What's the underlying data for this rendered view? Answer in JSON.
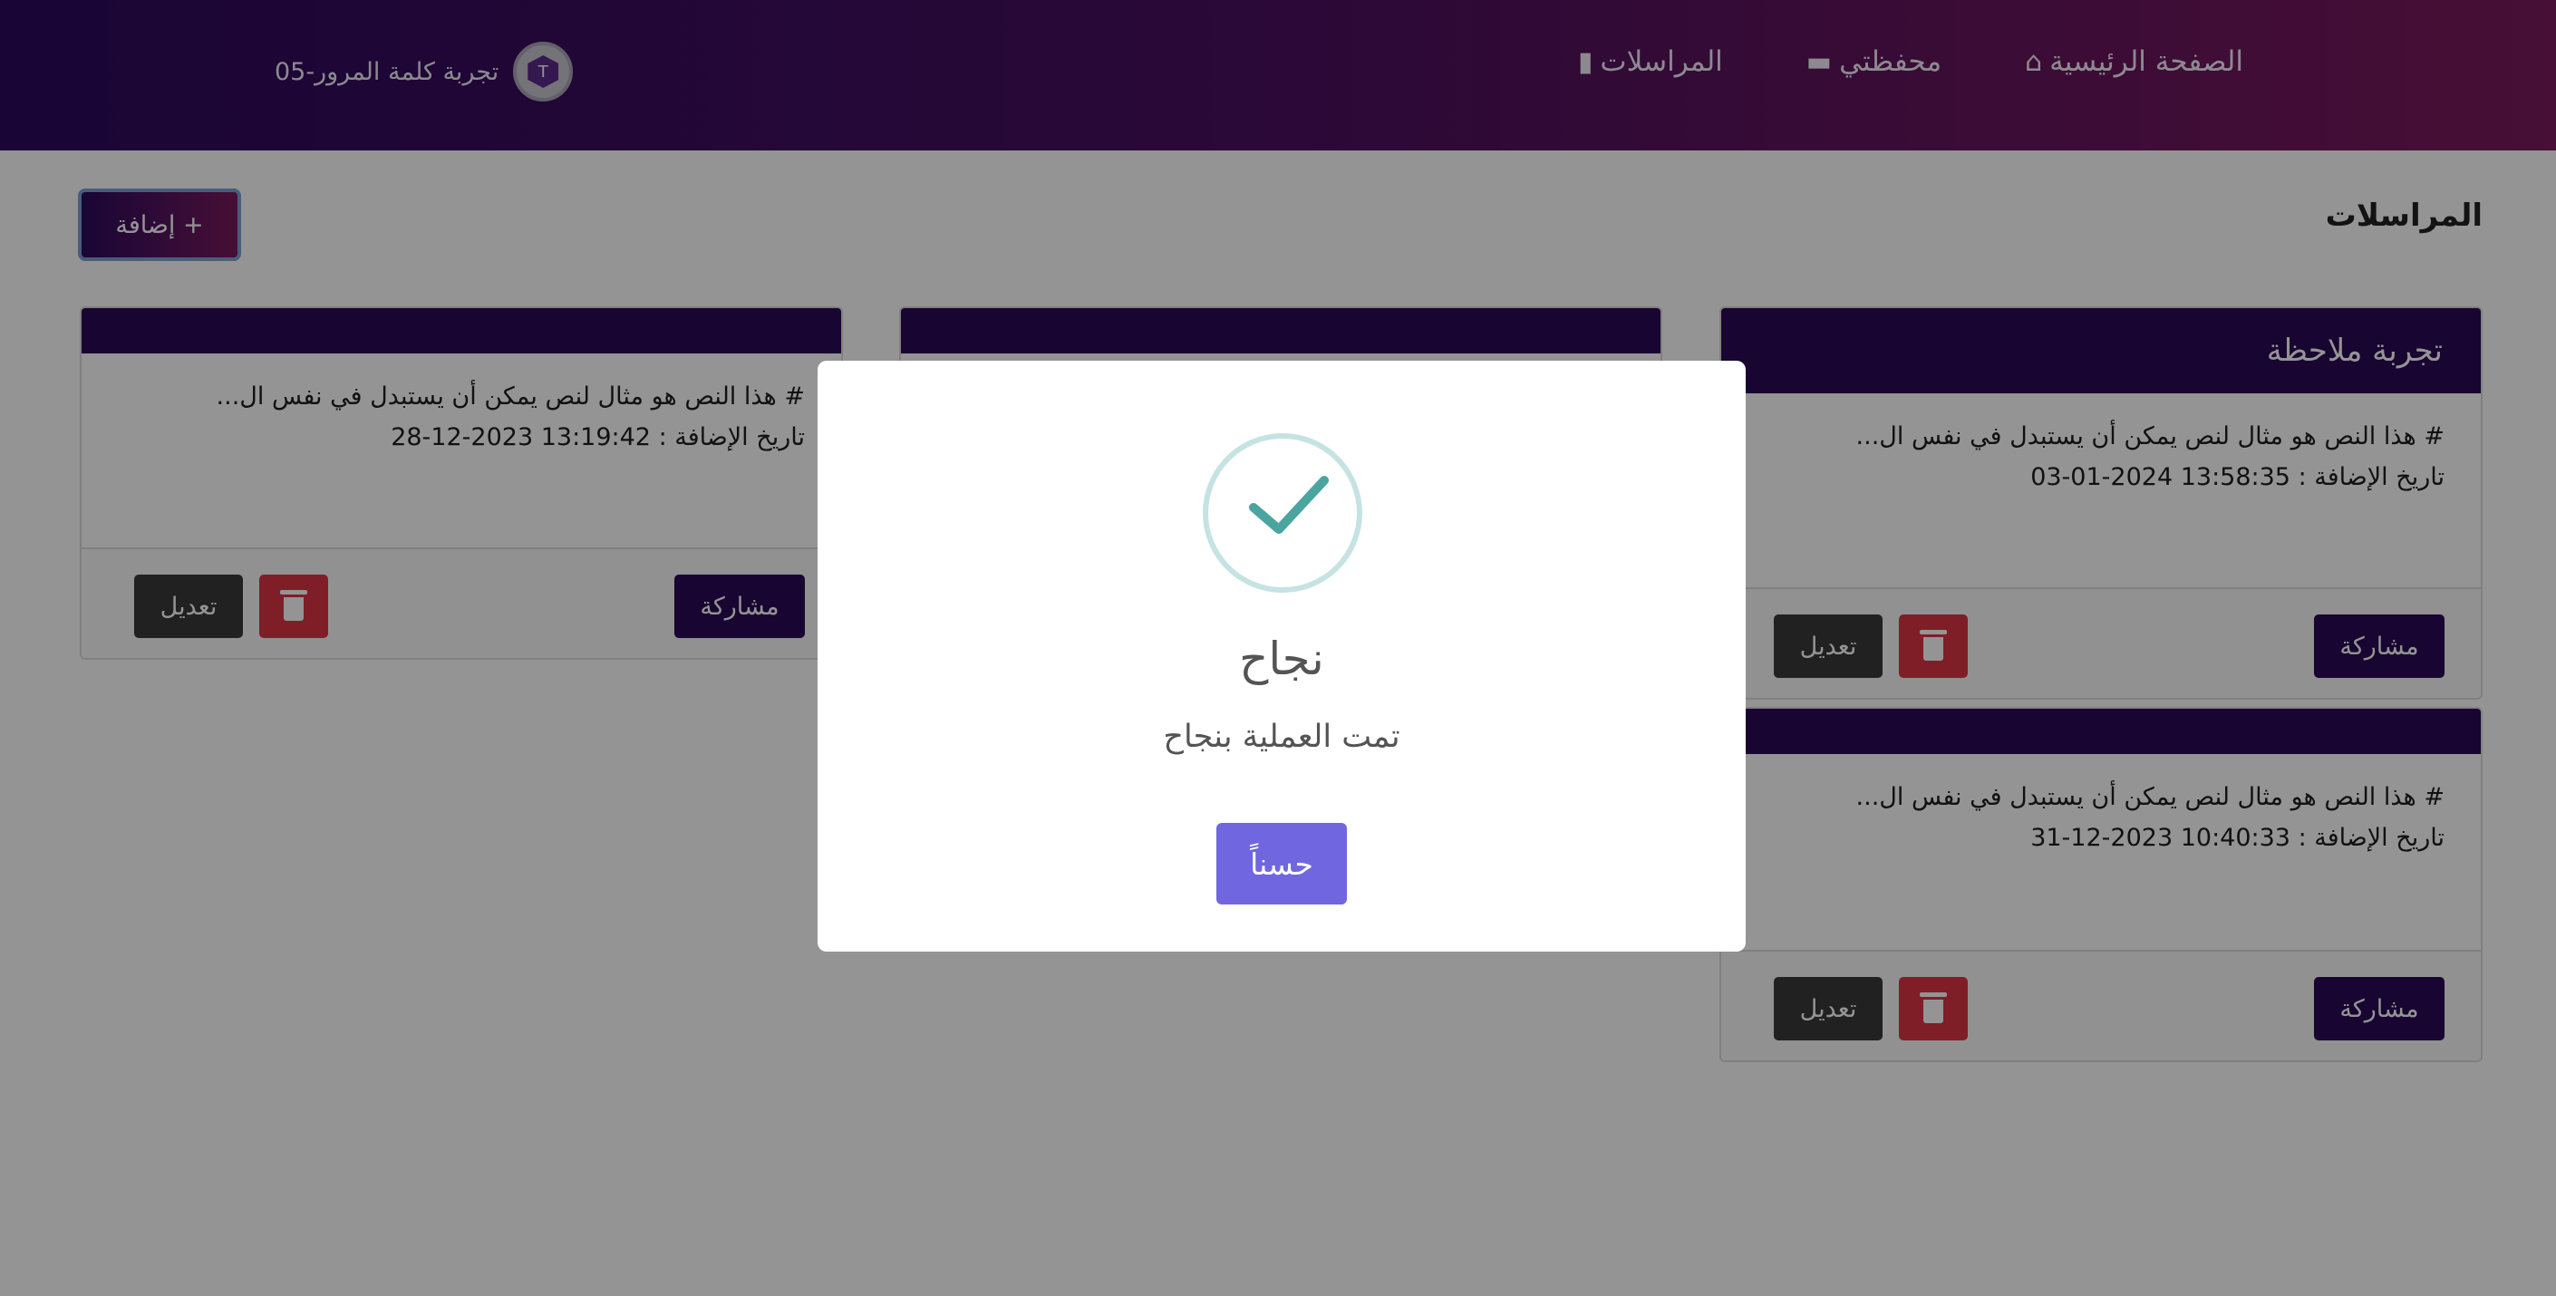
{
  "navbar": {
    "links": [
      {
        "label": "الصفحة الرئيسية",
        "icon": "home-icon"
      },
      {
        "label": "محفظتي",
        "icon": "wallet-icon"
      },
      {
        "label": "المراسلات",
        "icon": "clipboard-icon"
      }
    ],
    "brand_name": "تجربة كلمة المرور-05",
    "brand_logo_letter": "T"
  },
  "page": {
    "title": "المراسلات",
    "add_button": "إضافة +"
  },
  "cards": [
    {
      "title": "تجربة ملاحظة",
      "text": "# هذا النص هو مثال لنص يمكن أن يستبدل في نفس ال...",
      "date": "تاريخ الإضافة : 13:58:35 2024-01-03",
      "share": "مشاركة",
      "edit": "تعديل"
    },
    {
      "title": "",
      "text": "# هذا النص هو مثال لنص يمكن أن يستبدل في نفس ال...",
      "date": "تاريخ الإضافة : 10:40:33 2023-12-31",
      "share": "مشاركة",
      "edit": "تعديل"
    },
    {
      "title": "",
      "text": "# هذا النص هو مثال لنص يمكن أن يستبدل في نفس ال...",
      "date": "تاريخ الإضافة : 13:19:42 2023-12-28",
      "share": "مشاركة",
      "edit": "تعديل"
    }
  ],
  "modal": {
    "title": "نجاح",
    "text": "تمت العملية بنجاح",
    "ok": "حسناً"
  },
  "colors": {
    "primary": "#2a0a55",
    "danger": "#dc3545",
    "confirm": "#7066e0",
    "success_check": "#4aa59e"
  }
}
